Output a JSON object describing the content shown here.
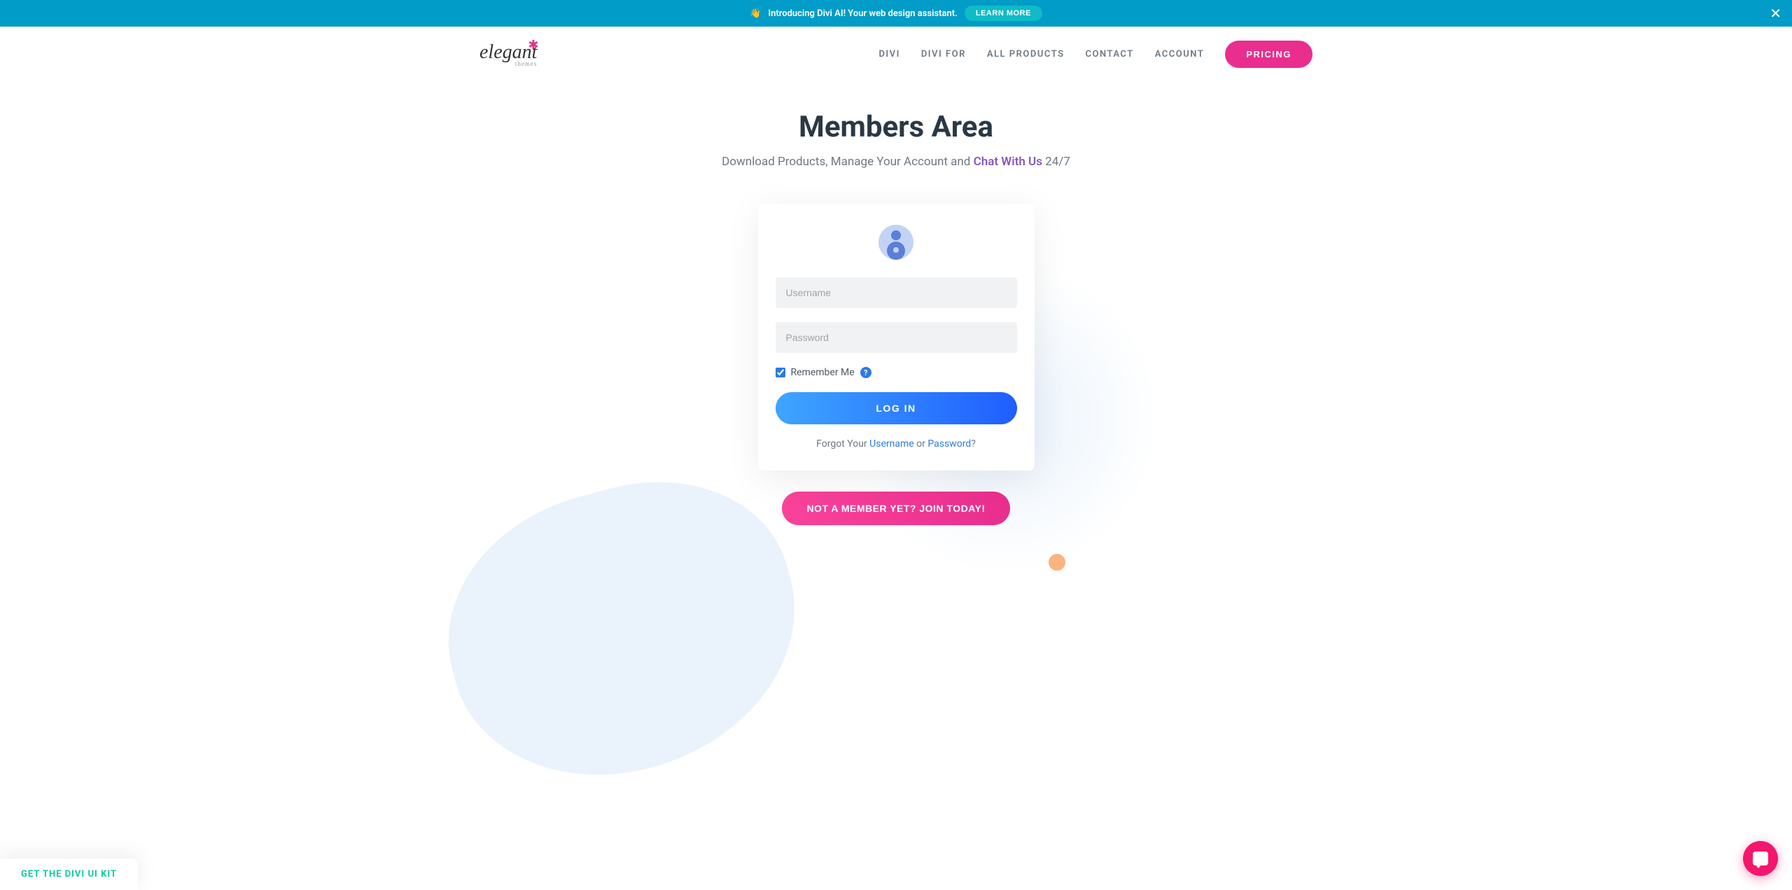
{
  "banner": {
    "emoji": "👋",
    "text": "Introducing Divi AI! Your web design assistant.",
    "button": "LEARN MORE"
  },
  "logo": {
    "main": "elegant",
    "sub": "themes"
  },
  "nav": {
    "items": [
      "DIVI",
      "DIVI FOR",
      "ALL PRODUCTS",
      "CONTACT",
      "ACCOUNT"
    ],
    "pricing": "PRICING"
  },
  "page": {
    "title": "Members Area",
    "subtitle_prefix": "Download Products, Manage Your Account and ",
    "subtitle_link": "Chat With Us",
    "subtitle_suffix": " 24/7"
  },
  "login": {
    "username_placeholder": "Username",
    "password_placeholder": "Password",
    "remember_label": "Remember Me",
    "help": "?",
    "submit": "LOG IN",
    "forgot_prefix": "Forgot Your ",
    "forgot_username": "Username",
    "forgot_or": " or ",
    "forgot_password": "Password",
    "forgot_suffix": "?"
  },
  "join": {
    "button": "NOT A MEMBER YET? JOIN TODAY!"
  },
  "uikit": {
    "label": "GET THE DIVI UI KIT"
  }
}
